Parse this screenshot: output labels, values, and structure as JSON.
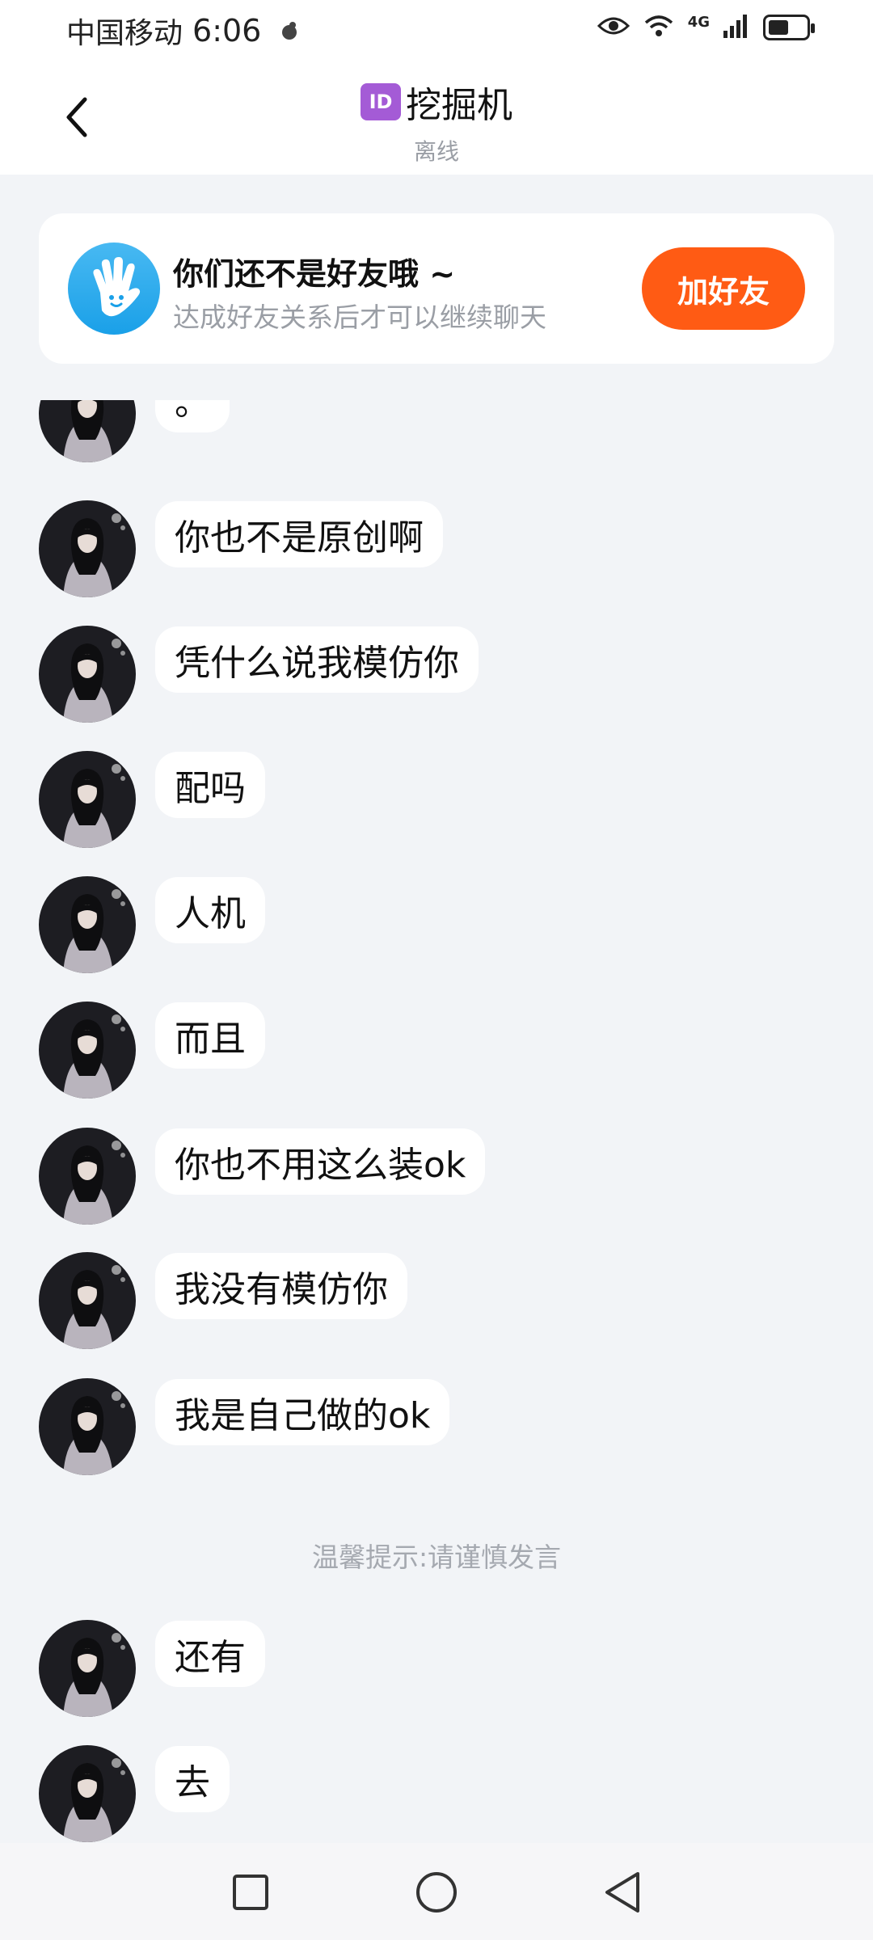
{
  "status_bar": {
    "carrier": "中国移动",
    "time": "6:06",
    "network": "4G",
    "battery_level": 0.55
  },
  "header": {
    "id_badge": "ID",
    "title": "挖掘机",
    "status": "离线"
  },
  "friend_card": {
    "title": "你们还不是好友哦 ~",
    "description": "达成好友关系后才可以继续聊天",
    "add_button": "加好友"
  },
  "messages": [
    {
      "text": "。"
    },
    {
      "text": "你也不是原创啊"
    },
    {
      "text": "凭什么说我模仿你"
    },
    {
      "text": "配吗"
    },
    {
      "text": "人机"
    },
    {
      "text": "而且"
    },
    {
      "text": "你也不用这么装ok"
    },
    {
      "text": "我没有模仿你"
    },
    {
      "text": "我是自己做的ok"
    },
    {
      "text": "还有"
    },
    {
      "text": "去"
    }
  ],
  "tip": "温馨提示:请谨慎发言",
  "colors": {
    "accent": "#ff5b14",
    "background": "#f2f4f7",
    "badge": "#a45bd6",
    "friend_icon": "#1aa0e8"
  }
}
